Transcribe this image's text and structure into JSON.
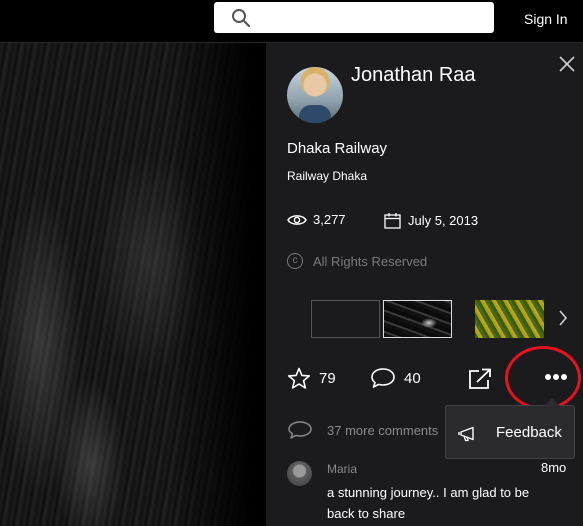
{
  "header": {
    "search_placeholder": "",
    "sign_in_label": "Sign In"
  },
  "photo": {
    "author_name": "Jonathan Raa",
    "title": "Dhaka Railway",
    "tags": "Railway Dhaka",
    "views": "3,277",
    "date": "July 5, 2013",
    "rights": "All Rights Reserved"
  },
  "actions": {
    "likes": "79",
    "comments": "40"
  },
  "comments": {
    "more_label": "37 more comments",
    "latest": {
      "author": "Maria",
      "time": "8mo",
      "text": "a stunning journey.. I am glad to be back to share"
    }
  },
  "popup": {
    "feedback_label": "Feedback"
  },
  "colors": {
    "panel_bg": "#1b1b1d",
    "highlight": "#e3141e",
    "muted_text": "#8a8a8a"
  }
}
